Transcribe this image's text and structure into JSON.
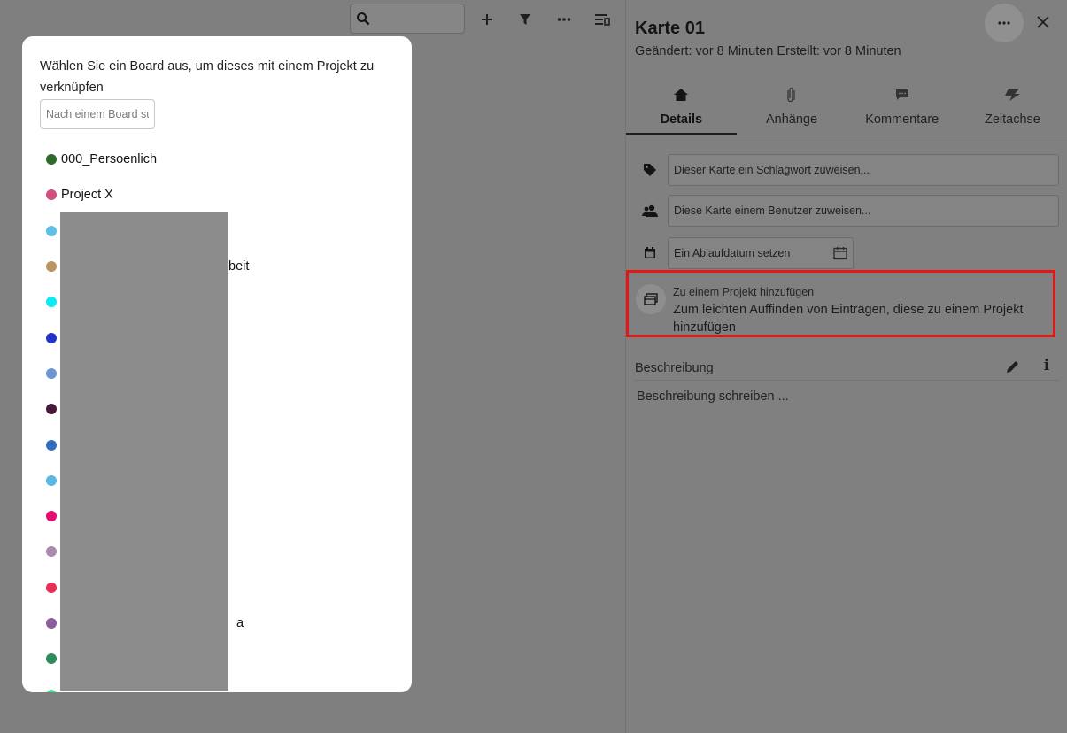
{
  "toolbar": {
    "icons": [
      "search-icon",
      "plus-icon",
      "filter-icon",
      "more-horizontal-icon",
      "view-list-icon"
    ]
  },
  "sidebar": {
    "title": "Karte 01",
    "meta": "Geändert: vor 8 Minuten Erstellt: vor 8 Minuten",
    "tabs": [
      {
        "label": "Details",
        "icon": "home-icon",
        "active": true
      },
      {
        "label": "Anhänge",
        "icon": "paperclip-icon",
        "active": false
      },
      {
        "label": "Kommentare",
        "icon": "comment-icon",
        "active": false
      },
      {
        "label": "Zeitachse",
        "icon": "flash-icon",
        "active": false
      }
    ],
    "tag_placeholder": "Dieser Karte ein Schlagwort zuweisen...",
    "user_placeholder": "Diese Karte einem Benutzer zuweisen...",
    "due_placeholder": "Ein Ablaufdatum setzen",
    "project": {
      "title": "Zu einem Projekt hinzufügen",
      "description": "Zum leichten Auffinden von Einträgen, diese zu einem Projekt hinzufügen",
      "highlight_color": "#e01818"
    },
    "description": {
      "label": "Beschreibung",
      "placeholder": "Beschreibung schreiben ..."
    }
  },
  "modal": {
    "title": "Wählen Sie ein Board aus, um dieses mit einem Projekt zu verknüpfen",
    "search_placeholder": "Nach einem Board suchen",
    "boards": [
      {
        "name": "000_Persoenlich",
        "color": "#2e6b2a"
      },
      {
        "name": "Project X",
        "color": "#d04f7f"
      },
      {
        "name": "",
        "color": "#62bfe4"
      },
      {
        "name": "beit",
        "color": "#b99560"
      },
      {
        "name": "",
        "color": "#10e8f2"
      },
      {
        "name": "",
        "color": "#2434c8"
      },
      {
        "name": "",
        "color": "#6e96d3"
      },
      {
        "name": "",
        "color": "#471a3c"
      },
      {
        "name": "",
        "color": "#2f6fbd"
      },
      {
        "name": "",
        "color": "#5ab7e6"
      },
      {
        "name": "",
        "color": "#e30c6f"
      },
      {
        "name": "",
        "color": "#a98cab"
      },
      {
        "name": "",
        "color": "#e82f55"
      },
      {
        "name": "a",
        "color": "#8b5c9e"
      },
      {
        "name": "",
        "color": "#2e8b5a"
      },
      {
        "name": "",
        "color": "#3fe79a"
      }
    ]
  }
}
